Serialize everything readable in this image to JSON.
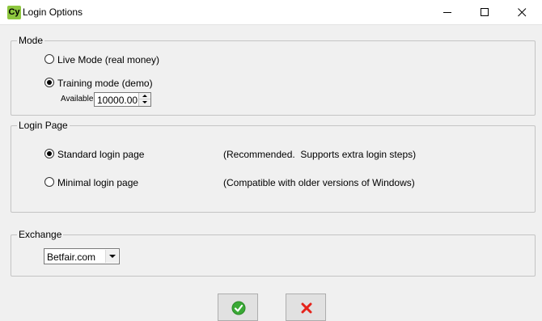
{
  "window": {
    "icon_text": "Cy",
    "title": "Login Options"
  },
  "mode": {
    "legend": "Mode",
    "live_label": "Live Mode (real money)",
    "training_label": "Training mode (demo)",
    "selected": "training",
    "available_label": "Available:",
    "available_value": "10000.00"
  },
  "login_page": {
    "legend": "Login Page",
    "standard_label": "Standard login page",
    "standard_desc": "(Recommended.  Supports extra login steps)",
    "minimal_label": "Minimal login page",
    "minimal_desc": "(Compatible with older versions of Windows)",
    "selected": "standard"
  },
  "exchange": {
    "legend": "Exchange",
    "selected_value": "Betfair.com"
  },
  "colors": {
    "ok_icon": "#3aa935",
    "cancel_icon": "#e5231b",
    "app_icon": "#8dc63f"
  },
  "icons": {
    "ok": "check-circle-icon",
    "cancel": "red-x-icon"
  }
}
